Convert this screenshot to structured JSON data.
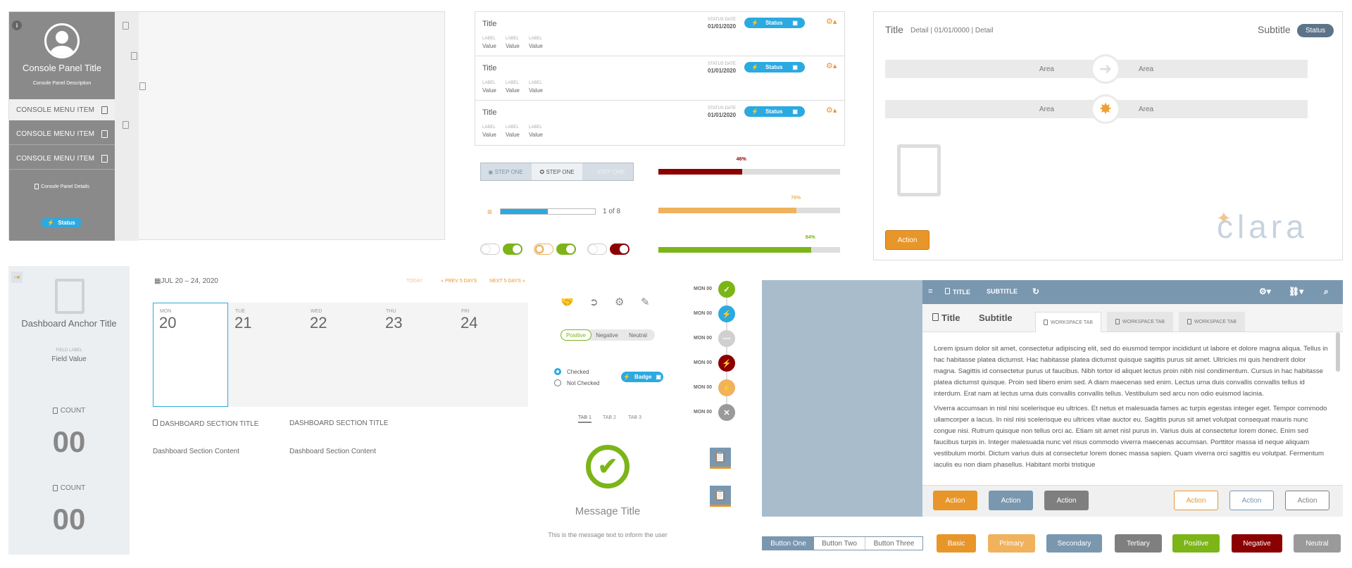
{
  "console": {
    "title": "Console Panel Title",
    "description": "Console Panel Description",
    "menu": [
      "CONSOLE MENU ITEM",
      "CONSOLE MENU ITEM",
      "CONSOLE MENU ITEM"
    ],
    "details": "Console Panel Details",
    "status": "Status"
  },
  "list": {
    "rows": [
      {
        "title": "Title",
        "date_label": "STATUS DATE",
        "date": "01/01/2020",
        "status": "Status",
        "fields": [
          {
            "label": "LABEL",
            "value": "Value"
          },
          {
            "label": "LABEL",
            "value": "Value"
          },
          {
            "label": "LABEL",
            "value": "Value"
          }
        ]
      },
      {
        "title": "Title",
        "date_label": "STATUS DATE",
        "date": "01/01/2020",
        "status": "Status",
        "fields": [
          {
            "label": "LABEL",
            "value": "Value"
          },
          {
            "label": "LABEL",
            "value": "Value"
          },
          {
            "label": "LABEL",
            "value": "Value"
          }
        ]
      },
      {
        "title": "Title",
        "date_label": "STATUS DATE",
        "date": "01/01/2020",
        "status": "Status",
        "fields": [
          {
            "label": "LABEL",
            "value": "Value"
          },
          {
            "label": "LABEL",
            "value": "Value"
          },
          {
            "label": "LABEL",
            "value": "Value"
          }
        ]
      }
    ]
  },
  "steps": [
    "STEP ONE",
    "STEP ONE",
    "STEP ONE"
  ],
  "pager": {
    "text": "1 of 8",
    "progress": 0.5
  },
  "progress": [
    {
      "label": "46%",
      "value": 0.46,
      "color": "#8b0000"
    },
    {
      "label": "76%",
      "value": 0.76,
      "color": "#f0b25c"
    },
    {
      "label": "84%",
      "value": 0.84,
      "color": "#7cb518"
    }
  ],
  "clara": {
    "title": "Title",
    "detail": "Detail | 01/01/0000 | Detail",
    "subtitle": "Subtitle",
    "status": "Status",
    "areas": [
      "Area",
      "Area",
      "Area",
      "Area"
    ],
    "action": "Action",
    "logo": "clara"
  },
  "anchor": {
    "title": "Dashboard Anchor Title",
    "field_label": "FIELD LABEL",
    "field_value": "Field Value",
    "counts": [
      {
        "label": "COUNT",
        "value": "00"
      },
      {
        "label": "COUNT",
        "value": "00"
      }
    ]
  },
  "calendar": {
    "range": "JUL 20 – 24, 2020",
    "today": "TODAY",
    "prev": "« PREV 5 DAYS",
    "next": "NEXT 5 DAYS »",
    "days": [
      {
        "name": "MON",
        "num": "20"
      },
      {
        "name": "TUE",
        "num": "21"
      },
      {
        "name": "WED",
        "num": "22"
      },
      {
        "name": "THU",
        "num": "23"
      },
      {
        "name": "FRI",
        "num": "24"
      }
    ]
  },
  "sections": [
    {
      "title": "DASHBOARD SECTION TITLE",
      "content": "Dashboard Section Content"
    },
    {
      "title": "DASHBOARD SECTION TITLE",
      "content": "Dashboard Section Content"
    }
  ],
  "segmented": [
    "Positive",
    "Negative",
    "Neutral"
  ],
  "radios": [
    "Checked",
    "Not Checked"
  ],
  "badge": "Badge",
  "tabs": [
    "TAB 1",
    "TAB 2",
    "TAB 3"
  ],
  "message": {
    "title": "Message Title",
    "text": "This is the message text to inform the user"
  },
  "timeline": [
    {
      "label": "MON 00",
      "color": "#7cb518",
      "icon": "✓"
    },
    {
      "label": "MON 00",
      "color": "#2ba9e1",
      "icon": "⚡"
    },
    {
      "label": "MON 00",
      "color": "#d0d0d0",
      "icon": "—"
    },
    {
      "label": "MON 00",
      "color": "#8b0000",
      "icon": "⚡"
    },
    {
      "label": "MON 00",
      "color": "#f0b25c",
      "icon": "⚡"
    },
    {
      "label": "MON 00",
      "color": "#9a9a9a",
      "icon": "✕"
    }
  ],
  "workspace": {
    "title": "TITLE",
    "subtitle": "SUBTITLE",
    "main_title": "Title",
    "main_subtitle": "Subtitle",
    "tabs": [
      "WORKSPACE TAB",
      "WORKSPACE TAB",
      "WORKSPACE TAB"
    ],
    "para1": "Lorem ipsum dolor sit amet, consectetur adipiscing elit, sed do eiusmod tempor incididunt ut labore et dolore magna aliqua. Tellus in hac habitasse platea dictumst. Hac habitasse platea dictumst quisque sagittis purus sit amet. Ultricies mi quis hendrerit dolor magna. Sagittis id consectetur purus ut faucibus. Nibh tortor id aliquet lectus proin nibh nisl condimentum. Cursus in hac habitasse platea dictumst quisque. Proin sed libero enim sed. A diam maecenas sed enim. Lectus urna duis convallis convallis tellus id interdum. Erat nam at lectus urna duis convallis convallis tellus. Vestibulum sed arcu non odio euismod lacinia.",
    "para2": "Viverra accumsan in nisl nisi scelerisque eu ultrices. Et netus et malesuada fames ac turpis egestas integer eget. Tempor commodo ullamcorper a lacus. In nisl nisi scelerisque eu ultrices vitae auctor eu. Sagittis purus sit amet volutpat consequat mauris nunc congue nisi. Rutrum quisque non tellus orci ac. Etiam sit amet nisl purus in. Varius duis at consectetur lorem donec. Enim sed faucibus turpis in. Integer malesuada nunc vel risus commodo viverra maecenas accumsan. Porttitor massa id neque aliquam vestibulum morbi. Dictum varius duis at consectetur lorem donec massa sapien. Quam viverra orci sagittis eu volutpat. Fermentum iaculis eu non diam phasellus. Habitant morbi tristique",
    "actions": [
      "Action",
      "Action",
      "Action",
      "Action",
      "Action",
      "Action"
    ]
  },
  "button_group": [
    "Button One",
    "Button Two",
    "Button Three"
  ],
  "buttons": [
    {
      "label": "Basic",
      "color": "#e8962a"
    },
    {
      "label": "Primary",
      "color": "#f0b25c"
    },
    {
      "label": "Secondary",
      "color": "#7a97b0"
    },
    {
      "label": "Tertiary",
      "color": "#7f7f7f"
    },
    {
      "label": "Positive",
      "color": "#7cb518"
    },
    {
      "label": "Negative",
      "color": "#8b0000"
    },
    {
      "label": "Neutral",
      "color": "#9a9a9a"
    }
  ]
}
